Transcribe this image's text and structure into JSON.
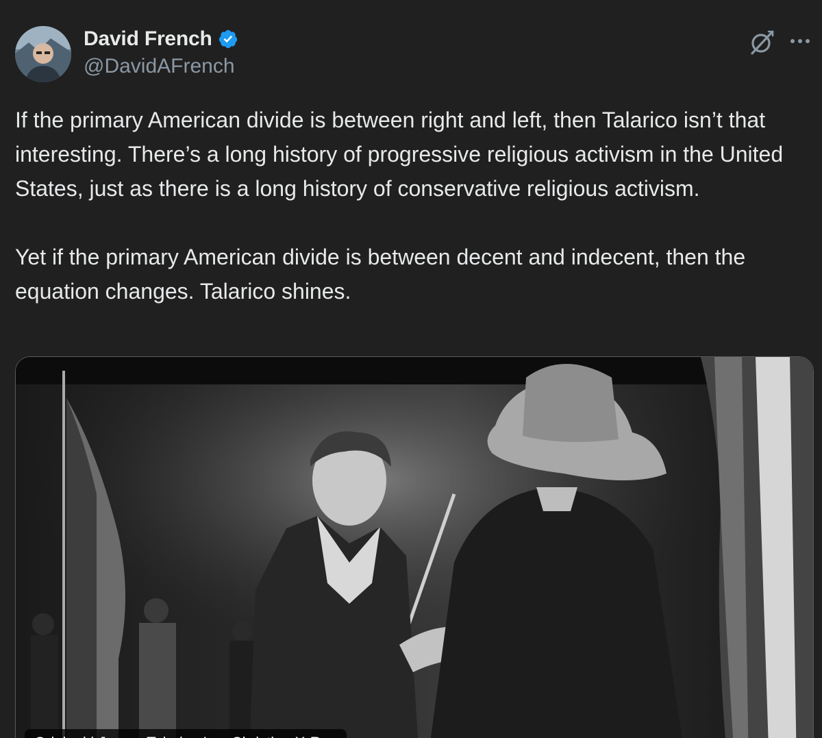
{
  "author": {
    "display_name": "David French",
    "handle": "@DavidAFrench",
    "verified": true,
    "verified_color": "#1d9bf0"
  },
  "actions": {
    "grok_icon": "grok-icon",
    "more_icon": "more-icon"
  },
  "tweet": {
    "paragraphs": [
      "If the primary American divide is between right and left, then Talarico isn’t that interesting. There’s a long history of progressive religious activism in the United States, just as there is a long history of conservative religious activism.",
      "Yet if the primary American divide is between decent and indecent, then the equation changes. Talarico shines."
    ]
  },
  "media": {
    "type": "photo",
    "caption": "Original | James Talarico Is a Christian X-Ray"
  },
  "colors": {
    "background": "#202020",
    "text": "#e7e9ea",
    "secondary_text": "#8b98a5",
    "accent": "#1d9bf0"
  }
}
